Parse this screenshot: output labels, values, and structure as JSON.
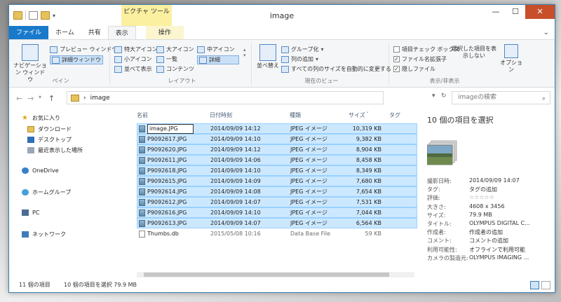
{
  "window": {
    "title": "image",
    "context_tab_header": "ピクチャ ツール",
    "minimize": "—",
    "maximize": "☐",
    "close": "✕"
  },
  "tabs": [
    {
      "label": "ファイル"
    },
    {
      "label": "ホーム"
    },
    {
      "label": "共有"
    },
    {
      "label": "表示"
    },
    {
      "label": "操作"
    }
  ],
  "ribbon": {
    "pane": {
      "nav_pane": "ナビゲーション ウィンドウ",
      "preview_pane": "プレビュー ウィンドウ",
      "details_pane": "詳細ウィンドウ",
      "group": "ペイン"
    },
    "layout": {
      "items": [
        "特大アイコン",
        "大アイコン",
        "中アイコン",
        "小アイコン",
        "一覧",
        "詳細",
        "並べて表示",
        "コンテンツ"
      ],
      "group": "レイアウト"
    },
    "current_view": {
      "sort": "並べ替え",
      "group_by": "グループ化",
      "add_columns": "列の追加",
      "size_all": "すべての列のサイズを自動的に変更する",
      "group": "現在のビュー"
    },
    "show_hide": {
      "item_checkboxes": "項目チェック ボックス",
      "file_extensions": "ファイル名拡張子",
      "hidden_items": "隠しファイル",
      "hide_selected": "選択した項目を表示しない",
      "options": "オプション",
      "group": "表示/非表示"
    }
  },
  "address": {
    "path": "image",
    "search_placeholder": "imageの検索"
  },
  "nav": {
    "favorites": "お気に入り",
    "downloads": "ダウンロード",
    "desktop": "デスクトップ",
    "recent": "最近表示した場所",
    "onedrive": "OneDrive",
    "homegroup": "ホームグループ",
    "pc": "PC",
    "network": "ネットワーク"
  },
  "columns": {
    "name": "名前",
    "date": "日付時刻",
    "type": "種類",
    "size": "サイズ",
    "tags": "タグ"
  },
  "files": [
    {
      "name": "image.JPG",
      "date": "2014/09/09 14:12",
      "type": "JPEG イメージ",
      "size": "10,319 KB",
      "selected": true,
      "editing": true,
      "icon": "jpg"
    },
    {
      "name": "P9092617.JPG",
      "date": "2014/09/09 14:10",
      "type": "JPEG イメージ",
      "size": "9,382 KB",
      "selected": true,
      "icon": "jpg"
    },
    {
      "name": "P9092620.JPG",
      "date": "2014/09/09 14:12",
      "type": "JPEG イメージ",
      "size": "8,904 KB",
      "selected": true,
      "icon": "jpg"
    },
    {
      "name": "P9092611.JPG",
      "date": "2014/09/09 14:06",
      "type": "JPEG イメージ",
      "size": "8,458 KB",
      "selected": true,
      "icon": "jpg"
    },
    {
      "name": "P9092618.JPG",
      "date": "2014/09/09 14:10",
      "type": "JPEG イメージ",
      "size": "8,349 KB",
      "selected": true,
      "icon": "jpg"
    },
    {
      "name": "P9092615.JPG",
      "date": "2014/09/09 14:09",
      "type": "JPEG イメージ",
      "size": "7,680 KB",
      "selected": true,
      "icon": "jpg"
    },
    {
      "name": "P9092614.JPG",
      "date": "2014/09/09 14:08",
      "type": "JPEG イメージ",
      "size": "7,654 KB",
      "selected": true,
      "icon": "jpg"
    },
    {
      "name": "P9092612.JPG",
      "date": "2014/09/09 14:07",
      "type": "JPEG イメージ",
      "size": "7,531 KB",
      "selected": true,
      "icon": "jpg"
    },
    {
      "name": "P9092616.JPG",
      "date": "2014/09/09 14:10",
      "type": "JPEG イメージ",
      "size": "7,044 KB",
      "selected": true,
      "icon": "jpg"
    },
    {
      "name": "P9092613.JPG",
      "date": "2014/09/09 14:07",
      "type": "JPEG イメージ",
      "size": "6,564 KB",
      "selected": true,
      "icon": "jpg"
    },
    {
      "name": "Thumbs.db",
      "date": "2015/05/08 10:16",
      "type": "Data Base File",
      "size": "59 KB",
      "selected": false,
      "icon": "db"
    }
  ],
  "details": {
    "title": "10 個の項目を選択",
    "props": [
      {
        "label": "撮影日時:",
        "value": "2014/09/09 14:07"
      },
      {
        "label": "タグ:",
        "value": "タグの追加"
      },
      {
        "label": "評価:",
        "value": "☆☆☆☆☆"
      },
      {
        "label": "大きさ:",
        "value": "4608 x 3456"
      },
      {
        "label": "サイズ:",
        "value": "79.9 MB"
      },
      {
        "label": "タイトル:",
        "value": "OLYMPUS DIGITAL C..."
      },
      {
        "label": "作成者:",
        "value": "作成者の追加"
      },
      {
        "label": "コメント:",
        "value": "コメントの追加"
      },
      {
        "label": "利用可能性:",
        "value": "オフラインで利用可能"
      },
      {
        "label": "カメラの製造元:",
        "value": "OLYMPUS IMAGING ..."
      }
    ]
  },
  "status": {
    "count": "11 個の項目",
    "selection": "10 個の項目を選択  79.9 MB"
  },
  "colors": {
    "file_tab": "#1979ca",
    "selection": "#cce8ff",
    "close_button": "#c7502b",
    "context_tab": "#fbf0a0"
  }
}
